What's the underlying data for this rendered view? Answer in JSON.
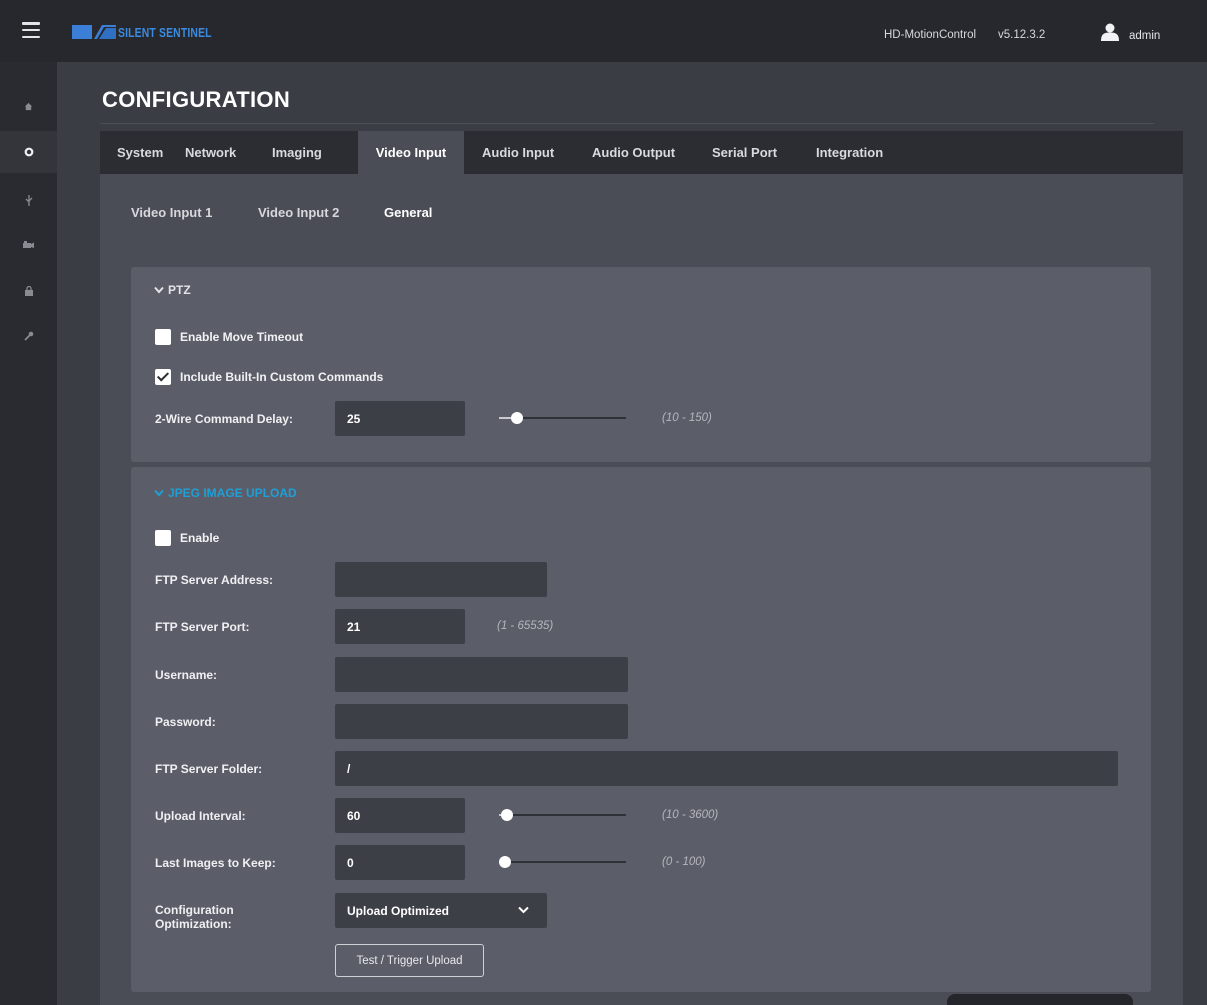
{
  "header": {
    "logo_text": "SILENT SENTINEL",
    "product_name": "HD-MotionControl",
    "version": "v5.12.3.2",
    "user": "admin",
    "colors": {
      "bar": "#27282d",
      "logo_blue": "#3b8be0"
    }
  },
  "sidebar": {
    "items": [
      {
        "icon": "home-icon",
        "glyph": "⌂",
        "active": false
      },
      {
        "icon": "gear-icon",
        "glyph": "⚙",
        "active": true
      },
      {
        "icon": "usb-icon",
        "glyph": "⚲",
        "active": false
      },
      {
        "icon": "camera-icon",
        "glyph": "▰",
        "active": false
      },
      {
        "icon": "lock-icon",
        "glyph": "🔒",
        "active": false
      },
      {
        "icon": "wrench-icon",
        "glyph": "🔧",
        "active": false
      }
    ]
  },
  "page": {
    "title": "CONFIGURATION"
  },
  "tabs": {
    "main": [
      "System",
      "Network",
      "Imaging",
      "Video Input",
      "Audio Input",
      "Audio Output",
      "Serial Port",
      "Integration"
    ],
    "main_active": "Video Input",
    "sub": [
      "Video Input 1",
      "Video Input 2",
      "General"
    ],
    "sub_active": "General"
  },
  "ptz": {
    "header": "PTZ",
    "enable_move_timeout": {
      "label": "Enable Move Timeout",
      "checked": false
    },
    "include_builtin": {
      "label": "Include Built-In Custom Commands",
      "checked": true
    },
    "command_delay": {
      "label": "2-Wire Command Delay:",
      "value": "25",
      "range": "(10 - 150)",
      "min": 10,
      "max": 150,
      "level": 25
    }
  },
  "jpeg": {
    "header": "JPEG IMAGE UPLOAD",
    "header_color": "#1e9fd8",
    "enable": {
      "label": "Enable",
      "checked": false
    },
    "ftp_address": {
      "label": "FTP Server Address:",
      "value": ""
    },
    "ftp_port": {
      "label": "FTP Server Port:",
      "value": "21",
      "range": "(1 - 65535)"
    },
    "username": {
      "label": "Username:",
      "value": ""
    },
    "password": {
      "label": "Password:",
      "value": ""
    },
    "ftp_folder": {
      "label": "FTP Server Folder:",
      "value": "/"
    },
    "upload_interval": {
      "label": "Upload Interval:",
      "value": "60",
      "range": "(10 - 3600)",
      "min": 10,
      "max": 3600,
      "level": 60
    },
    "last_images": {
      "label": "Last Images to Keep:",
      "value": "0",
      "range": "(0 - 100)",
      "min": 0,
      "max": 100,
      "level": 0
    },
    "optimization": {
      "label": "Configuration Optimization:",
      "value": "Upload Optimized"
    },
    "test_button": "Test / Trigger Upload"
  }
}
